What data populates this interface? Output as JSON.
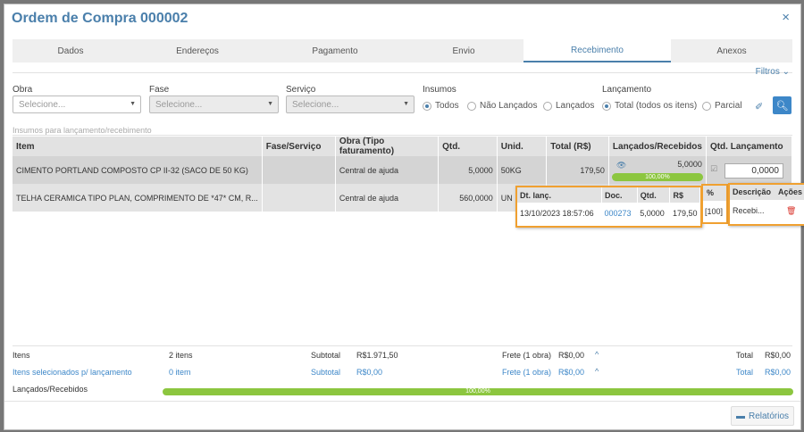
{
  "dialog": {
    "title": "Ordem de Compra 000002",
    "close_icon": "×"
  },
  "tabs": [
    {
      "label": "Dados"
    },
    {
      "label": "Endereços"
    },
    {
      "label": "Pagamento"
    },
    {
      "label": "Envio"
    },
    {
      "label": "Recebimento",
      "active": true
    },
    {
      "label": "Anexos"
    }
  ],
  "filters": {
    "toggle_label": "Filtros",
    "obra": {
      "label": "Obra",
      "placeholder": "Selecione..."
    },
    "fase": {
      "label": "Fase",
      "placeholder": "Selecione..."
    },
    "servico": {
      "label": "Serviço",
      "placeholder": "Selecione..."
    },
    "insumos": {
      "label": "Insumos",
      "options": [
        "Todos",
        "Não Lançados",
        "Lançados"
      ],
      "selected": "Todos"
    },
    "lancamento": {
      "label": "Lançamento",
      "options": [
        "Total (todos os itens)",
        "Parcial"
      ],
      "selected": "Total (todos os itens)"
    }
  },
  "section_label": "Insumos para lançamento/recebimento",
  "table": {
    "headers": [
      "Item",
      "Fase/Serviço",
      "Obra (Tipo faturamento)",
      "Qtd.",
      "Unid.",
      "Total (R$)",
      "Lançados/Recebidos",
      "Qtd. Lançamento"
    ],
    "rows": [
      {
        "item": "CIMENTO PORTLAND COMPOSTO CP II-32 (SACO DE 50 KG)",
        "fase": "",
        "obra": "Central de ajuda",
        "qtd": "5,0000",
        "unid": "50KG",
        "total": "179,50",
        "lancados": "5,0000",
        "progress_label": "100,00%",
        "progress": 1.0,
        "qtd_lancamento": "0,0000"
      },
      {
        "item": "TELHA CERAMICA TIPO PLAN, COMPRIMENTO DE *47* CM, R...",
        "fase": "",
        "obra": "Central de ajuda",
        "qtd": "560,0000",
        "unid": "UN",
        "total": "",
        "lancados": "",
        "progress_label": "",
        "qtd_lancamento": ""
      }
    ]
  },
  "popup": {
    "headers": [
      "Dt. lanç.",
      "Doc.",
      "Qtd.",
      "R$",
      "%",
      "Descrição",
      "Ações"
    ],
    "row": {
      "date": "13/10/2023 18:57:06",
      "doc": "000273",
      "qtd": "5,0000",
      "rs": "179,50",
      "pct": "[100]",
      "desc": "Recebi..."
    }
  },
  "footer": {
    "itens_label": "Itens",
    "itens_value": "2 itens",
    "subtotal_label": "Subtotal",
    "subtotal_value": "R$1.971,50",
    "frete_label": "Frete (1 obra)",
    "frete_value": "R$0,00",
    "total_label": "Total",
    "total_value": "R$0,00",
    "sel_label": "Itens selecionados p/ lançamento",
    "sel_value": "0 item",
    "sel_subtotal_label": "Subtotal",
    "sel_subtotal_value": "R$0,00",
    "sel_frete_label": "Frete (1 obra)",
    "sel_frete_value": "R$0,00",
    "sel_total_label": "Total",
    "sel_total_value": "R$0,00",
    "lr_label": "Lançados/Recebidos",
    "lr_progress_label": "100,00%",
    "lr_progress": 1.0
  },
  "relatorios_label": "Relatórios"
}
